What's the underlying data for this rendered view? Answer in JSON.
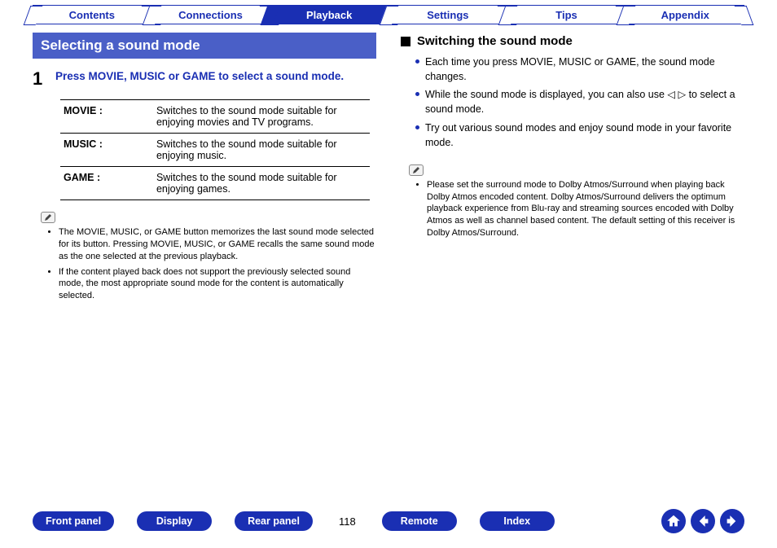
{
  "topnav": {
    "tabs": [
      {
        "label": "Contents",
        "active": false
      },
      {
        "label": "Connections",
        "active": false
      },
      {
        "label": "Playback",
        "active": true
      },
      {
        "label": "Settings",
        "active": false
      },
      {
        "label": "Tips",
        "active": false
      },
      {
        "label": "Appendix",
        "active": false
      }
    ]
  },
  "left": {
    "section_title": "Selecting a sound mode",
    "step_number": "1",
    "step_text": "Press MOVIE, MUSIC or GAME to select a sound mode.",
    "table": [
      {
        "label": "MOVIE :",
        "desc": "Switches to the sound mode suitable for enjoying movies and TV programs."
      },
      {
        "label": "MUSIC :",
        "desc": "Switches to the sound mode suitable for enjoying music."
      },
      {
        "label": "GAME :",
        "desc": "Switches to the sound mode suitable for enjoying games."
      }
    ],
    "notes": [
      "The MOVIE, MUSIC, or GAME button memorizes the last sound mode selected for its button. Pressing MOVIE, MUSIC, or GAME recalls the same sound mode as the one selected at the previous playback.",
      "If the content played back does not support the previously selected sound mode, the most appropriate sound mode for the content is automatically selected."
    ]
  },
  "right": {
    "subhead": "Switching the sound mode",
    "bullets": [
      "Each time you press MOVIE, MUSIC or GAME, the sound mode changes.",
      "While the sound mode is displayed, you can also use ◁ ▷ to select a sound mode.",
      "Try out various sound modes and enjoy sound mode in your favorite mode."
    ],
    "notes": [
      "Please set the surround mode to Dolby Atmos/Surround when playing back Dolby Atmos encoded content. Dolby Atmos/Surround delivers the optimum playback experience from Blu-ray and streaming sources encoded with Dolby Atmos as well as channel based content. The default setting of this receiver is Dolby Atmos/Surround."
    ]
  },
  "bottom": {
    "buttons": [
      {
        "label": "Front panel"
      },
      {
        "label": "Display"
      },
      {
        "label": "Rear panel"
      }
    ],
    "page_number": "118",
    "buttons_right": [
      {
        "label": "Remote"
      },
      {
        "label": "Index"
      }
    ],
    "icons": {
      "home": "home-icon",
      "prev": "arrow-left-icon",
      "next": "arrow-right-icon"
    }
  }
}
